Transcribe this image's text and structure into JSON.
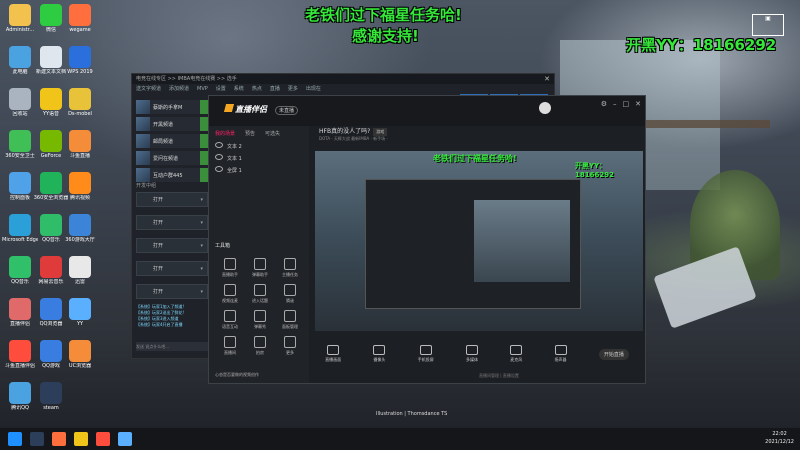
{
  "desktop": {
    "icons": [
      {
        "label": "Administr...",
        "color": "#f2c14e"
      },
      {
        "label": "微信",
        "color": "#2ecc40"
      },
      {
        "label": "wegame",
        "color": "#ff6f3d"
      },
      {
        "label": "此电脑",
        "color": "#4aa3e0"
      },
      {
        "label": "新建文本文档",
        "color": "#dfe6ee"
      },
      {
        "label": "WPS 2019",
        "color": "#2a6fdb"
      },
      {
        "label": "回收站",
        "color": "#aab4c0"
      },
      {
        "label": "YY语音",
        "color": "#f0c419"
      },
      {
        "label": "Ds-mobel",
        "color": "#e8c33a"
      },
      {
        "label": "360安全卫士",
        "color": "#3fbf55"
      },
      {
        "label": "GeForce",
        "color": "#76b900"
      },
      {
        "label": "斗鱼直播",
        "color": "#f58c3a"
      },
      {
        "label": "控制面板",
        "color": "#4fa1e8"
      },
      {
        "label": "360安全浏览器",
        "color": "#21b35a"
      },
      {
        "label": "腾讯视频",
        "color": "#ff8c1a"
      },
      {
        "label": "Microsoft Edge",
        "color": "#2b9fd8"
      },
      {
        "label": "QQ音乐",
        "color": "#2fbd69"
      },
      {
        "label": "360游戏大厅",
        "color": "#3b84d8"
      },
      {
        "label": "QQ音乐",
        "color": "#30c06a"
      },
      {
        "label": "网易云音乐",
        "color": "#e03b3b"
      },
      {
        "label": "迅雷",
        "color": "#e8e8e8"
      },
      {
        "label": "直播伴侣",
        "color": "#e06a6a"
      },
      {
        "label": "QQ浏览器",
        "color": "#3a7de0"
      },
      {
        "label": "YY",
        "color": "#5ab0ff"
      },
      {
        "label": "斗鱼直播伴侣",
        "color": "#ff4d3d"
      },
      {
        "label": "QQ游戏",
        "color": "#3a7de0"
      },
      {
        "label": "UC浏览器",
        "color": "#f58c3a"
      },
      {
        "label": "腾讯QQ",
        "color": "#4aa3e0"
      },
      {
        "label": "steam",
        "color": "#2c3e5a"
      }
    ]
  },
  "overlay": {
    "line1": "老铁们过下福星任务哈!",
    "line2": "感谢支持!",
    "yy": "开黑YY：18166292"
  },
  "left_app": {
    "title": "电竞在线专区 >> IMBA电竞在线赛 >> 选手",
    "menu": [
      "送文字频道",
      "添加频道",
      "MVP",
      "设置",
      "系统",
      "热点",
      "直播",
      "更多",
      "出现在"
    ],
    "top_tabs": [
      "频道设置",
      "个人频道",
      "我的频道"
    ],
    "channels": [
      {
        "name": "蔡斯的手拿M"
      },
      {
        "name": "开黑频道"
      },
      {
        "name": "邮局频道"
      },
      {
        "name": "爱问在频道"
      },
      {
        "name": "互动户群445"
      }
    ],
    "friends_header": "开发中组",
    "friends": [
      "打开",
      "打开",
      "打开",
      "打开",
      "打开"
    ],
    "chat_lines": [
      "【系统】玩家1加入了频道!",
      "【系统】玩家2送出了鲜花!",
      "【系统】玩家3进入频道",
      "【系统】玩家4开启了直播"
    ],
    "chat_input_placeholder": "发送  说点什么吧..."
  },
  "stream_window": {
    "logo": "直播伴侣",
    "badge": "未直播",
    "tabs": [
      "我的场景",
      "预告",
      "可选失"
    ],
    "scenes": [
      "文本 2",
      "文本 1",
      "全屏 1"
    ],
    "tools_header": "工具箱",
    "tools": [
      {
        "label": "直播助手"
      },
      {
        "label": "弹幕助手"
      },
      {
        "label": "主播任务"
      },
      {
        "label": "视频连麦"
      },
      {
        "label": "进入话题"
      },
      {
        "label": "猜谜"
      },
      {
        "label": "语音互动"
      },
      {
        "label": "弹幕秀"
      },
      {
        "label": "面板管理"
      },
      {
        "label": "直播间"
      },
      {
        "label": "拍房"
      },
      {
        "label": "更多"
      }
    ],
    "status": "心态是否要做的视频创作",
    "header_title": "HFB真的没人了吗?",
    "header_tag": "游戏",
    "header_sub": "DOTA · 天辉大战   最新IMBA · 新手场   ·",
    "preview_overlay1": "老铁们过下福星任务哈!",
    "preview_overlay2": "开黑YY：18166292",
    "bottom_buttons": [
      "直播画面",
      "摄像头",
      "手机投屏",
      "多媒体",
      "麦克风",
      "扬声器"
    ],
    "live_button": "开始直播",
    "footer": "直播间管理   |   直播设置"
  },
  "credit": "Illustration | Thomsdance TS",
  "taskbar": {
    "icons": [
      "#2c3e5a",
      "#ff6f3d",
      "#f0c419",
      "#ff4d3d",
      "#5ab0ff"
    ],
    "time": "22:02",
    "date": "2021/12/12",
    "tray": "中"
  }
}
